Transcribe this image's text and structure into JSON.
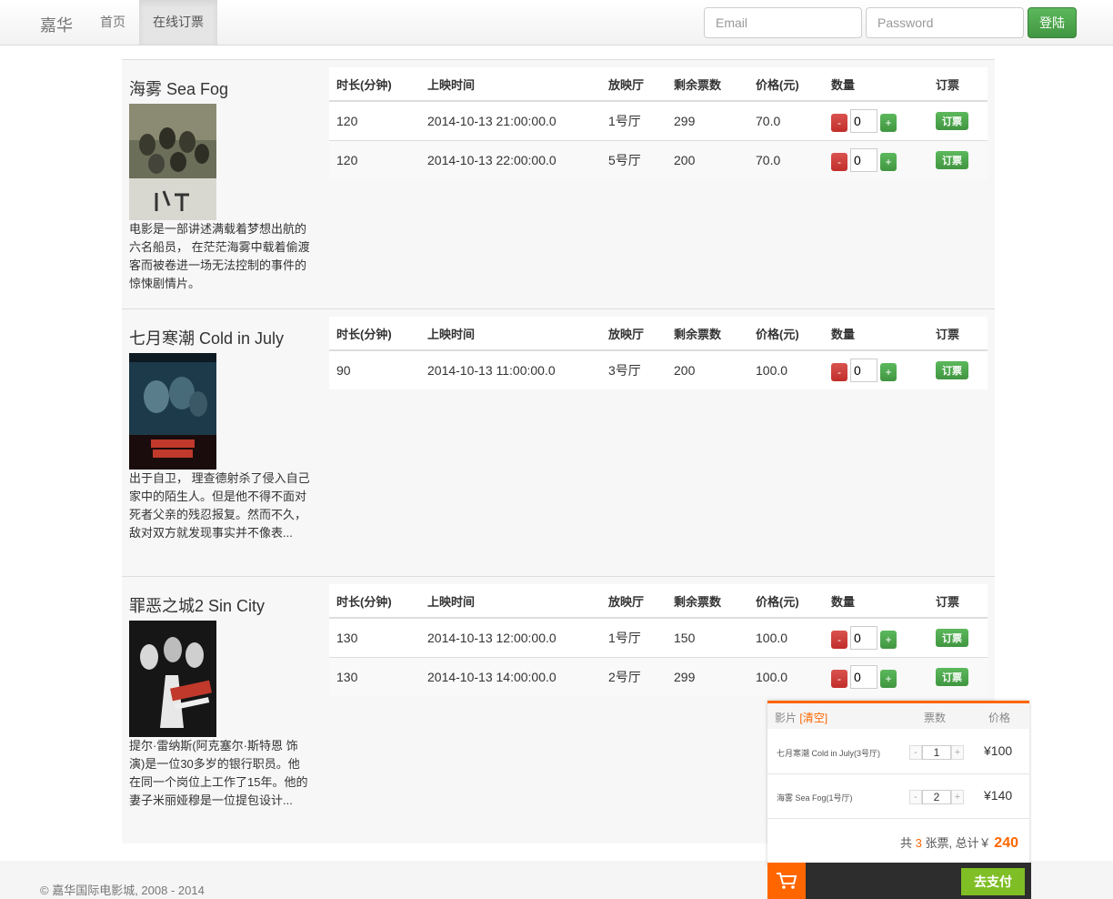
{
  "nav": {
    "brand": "嘉华",
    "links": [
      "首页",
      "在线订票"
    ],
    "email_placeholder": "Email",
    "password_placeholder": "Password",
    "login_label": "登陆"
  },
  "table_headers": [
    "时长(分钟)",
    "上映时间",
    "放映厅",
    "剩余票数",
    "价格(元)",
    "数量",
    "订票"
  ],
  "order_label": "订票",
  "minus_label": "-",
  "plus_label": "+",
  "movies": [
    {
      "title": "海雾 Sea Fog",
      "description": "电影是一部讲述满载着梦想出航的六名船员， 在茫茫海雾中载着偷渡客而被卷进一场无法控制的事件的惊悚剧情片。",
      "showtimes": [
        {
          "duration": "120",
          "time": "2014-10-13 21:00:00.0",
          "hall": "1号厅",
          "remaining": "299",
          "price": "70.0",
          "qty": "0"
        },
        {
          "duration": "120",
          "time": "2014-10-13 22:00:00.0",
          "hall": "5号厅",
          "remaining": "200",
          "price": "70.0",
          "qty": "0"
        }
      ]
    },
    {
      "title": "七月寒潮 Cold in July",
      "description": "出于自卫， 理查德射杀了侵入自己家中的陌生人。但是他不得不面对死者父亲的残忍报复。然而不久，敌对双方就发现事实并不像表...",
      "showtimes": [
        {
          "duration": "90",
          "time": "2014-10-13 11:00:00.0",
          "hall": "3号厅",
          "remaining": "200",
          "price": "100.0",
          "qty": "0"
        }
      ]
    },
    {
      "title": "罪恶之城2 Sin City",
      "description": "提尔·雷纳斯(阿克塞尔·斯特恩 饰演)是一位30多岁的银行职员。他在同一个岗位上工作了15年。他的妻子米丽娅穆是一位提包设计...",
      "showtimes": [
        {
          "duration": "130",
          "time": "2014-10-13 12:00:00.0",
          "hall": "1号厅",
          "remaining": "150",
          "price": "100.0",
          "qty": "0"
        },
        {
          "duration": "130",
          "time": "2014-10-13 14:00:00.0",
          "hall": "2号厅",
          "remaining": "299",
          "price": "100.0",
          "qty": "0"
        }
      ]
    }
  ],
  "footer": {
    "copyright": "© 嘉华国际电影城, 2008 - 2014"
  },
  "cart": {
    "header_film": "影片",
    "clear_label": "[清空]",
    "header_count": "票数",
    "header_price": "价格",
    "items": [
      {
        "name": "七月寒潮 Cold in July(3号厅)",
        "qty": "1",
        "price": "¥100"
      },
      {
        "name": "海雾 Sea Fog(1号厅)",
        "qty": "2",
        "price": "¥140"
      }
    ],
    "total_prefix": "共",
    "ticket_count": "3",
    "total_mid": "张票,  总计￥",
    "total_amount": "240",
    "pay_label": "去支付",
    "icon": "cart-icon",
    "accent_color": "#ff6600"
  }
}
